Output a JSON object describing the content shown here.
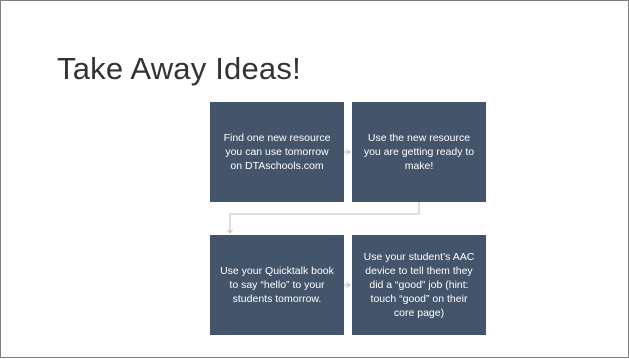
{
  "slide": {
    "title": "Take Away Ideas!"
  },
  "steps": [
    {
      "text": "Find one new resource you can use tomorrow on DTAschools.com"
    },
    {
      "text": "Use the new resource you are getting ready to make!"
    },
    {
      "text": "Use your Quicktalk book to say “hello” to your students tomorrow."
    },
    {
      "text": "Use your student’s AAC device to tell them they did a “good” job (hint: touch “good” on their core page)"
    }
  ],
  "colors": {
    "box_fill": "#44546a",
    "box_text": "#ffffff",
    "connector": "#bfbfbf",
    "title": "#333333"
  }
}
